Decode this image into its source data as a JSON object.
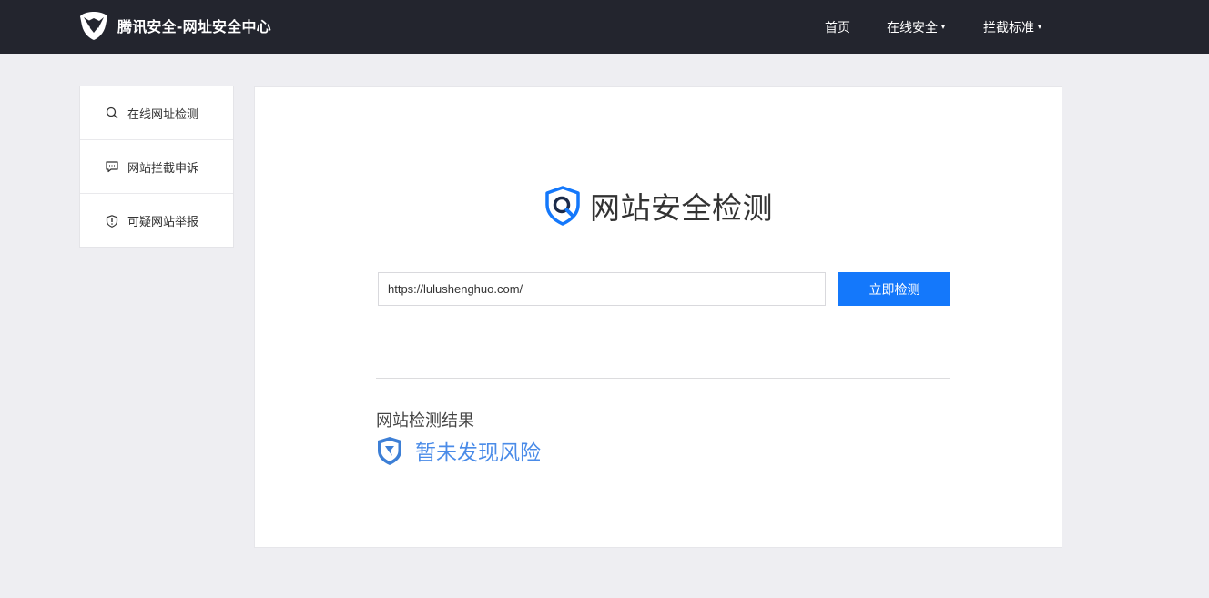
{
  "header": {
    "brand_title": "腾讯安全-网址安全中心",
    "nav": [
      {
        "label": "首页"
      },
      {
        "label": "在线安全",
        "caret": "▾"
      },
      {
        "label": "拦截标准",
        "caret": "▾"
      }
    ]
  },
  "sidebar": {
    "items": [
      {
        "label": "在线网址检测",
        "icon": "search-icon"
      },
      {
        "label": "网站拦截申诉",
        "icon": "message-icon"
      },
      {
        "label": "可疑网站举报",
        "icon": "shield-alert-icon"
      }
    ]
  },
  "main": {
    "hero_title": "网站安全检测",
    "url_value": "https://lulushenghuo.com/",
    "check_button": "立即检测",
    "result_label": "网站检测结果",
    "result_text": "暂未发现风险"
  },
  "colors": {
    "topbar": "#23252e",
    "accent": "#1478fb",
    "result": "#4a8be8",
    "background": "#eeeef2"
  }
}
